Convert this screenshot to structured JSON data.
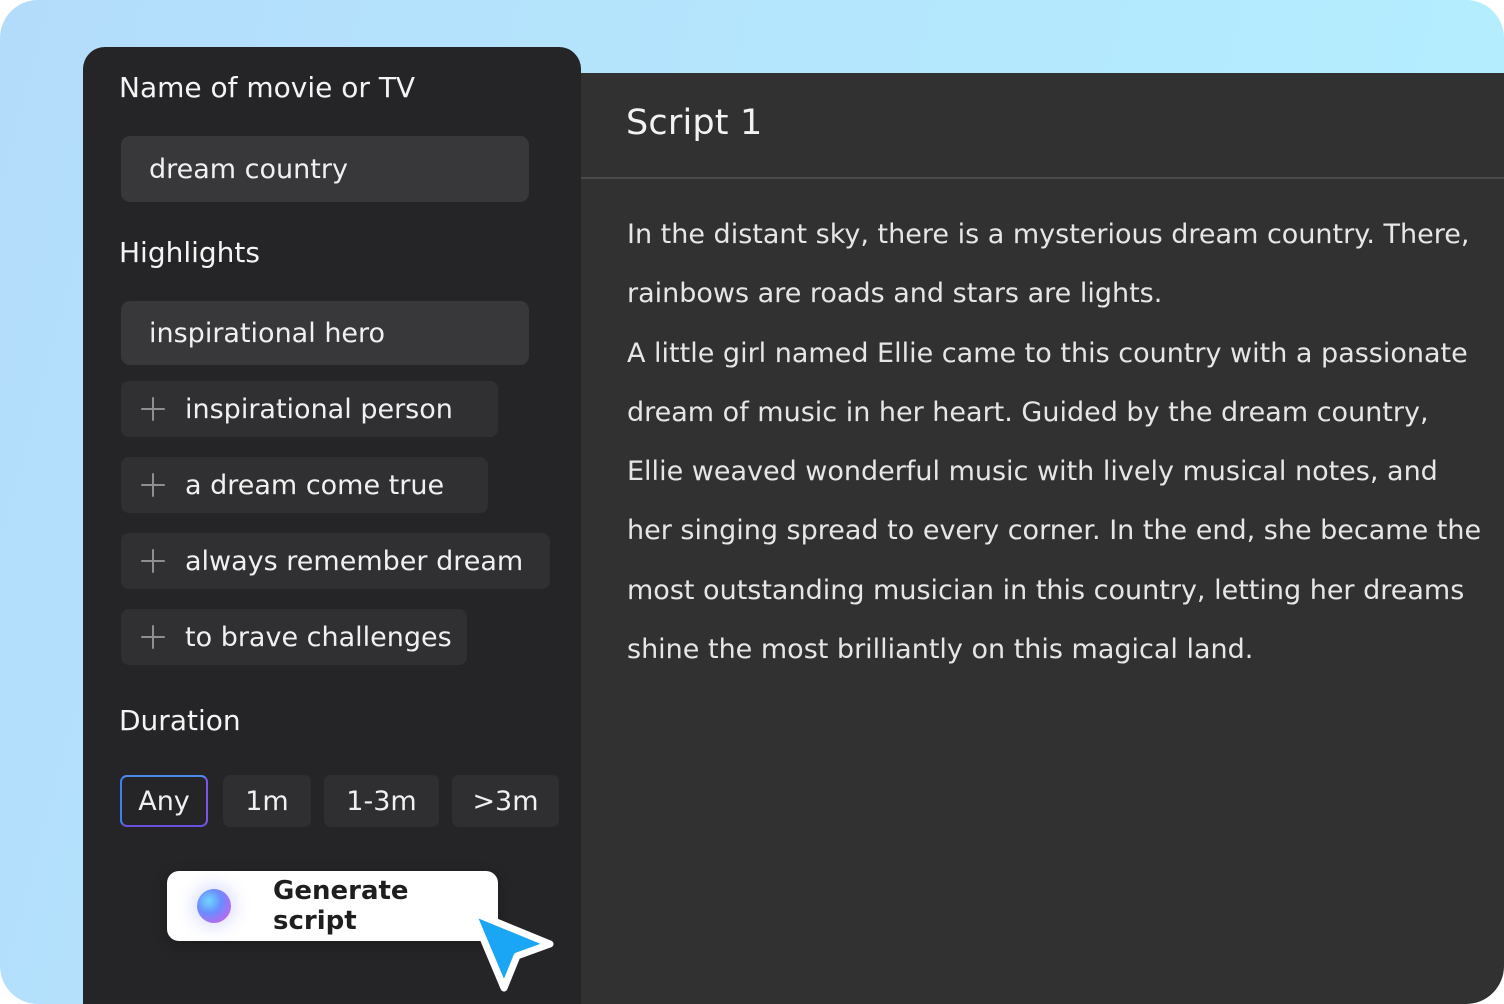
{
  "name_section": {
    "label": "Name of movie or TV",
    "value": "dream country"
  },
  "highlights_section": {
    "label": "Highlights",
    "value": "inspirational hero",
    "suggestions": [
      "inspirational person",
      "a dream come true",
      "always remember dream",
      "to brave challenges"
    ]
  },
  "duration_section": {
    "label": "Duration",
    "options": [
      "Any",
      "1m",
      "1-3m",
      ">3m"
    ],
    "selected": "Any"
  },
  "generate_button": {
    "label": "Generate script"
  },
  "script": {
    "title": "Script 1",
    "paragraphs": [
      "In the distant sky, there is a mysterious dream country. There, rainbows are roads and stars are lights.",
      "A little girl named Ellie came to this country with a passionate dream of music in her heart. Guided by the dream country, Ellie weaved wonderful music with lively musical notes, and her singing spread to every corner. In the end, she became the most outstanding musician in this country, letting her dreams shine the most brilliantly on this magical land."
    ]
  },
  "icons": {
    "suggestion_add": "plus-icon",
    "generate": "ai-orb-icon",
    "pointer": "cursor-arrow-icon"
  },
  "colors": {
    "panel_dark": "#252527",
    "script_panel": "#313131",
    "selected_border": "#5a63e6",
    "cursor": "#1aa6f5",
    "background_top": "#b3f0fe"
  }
}
